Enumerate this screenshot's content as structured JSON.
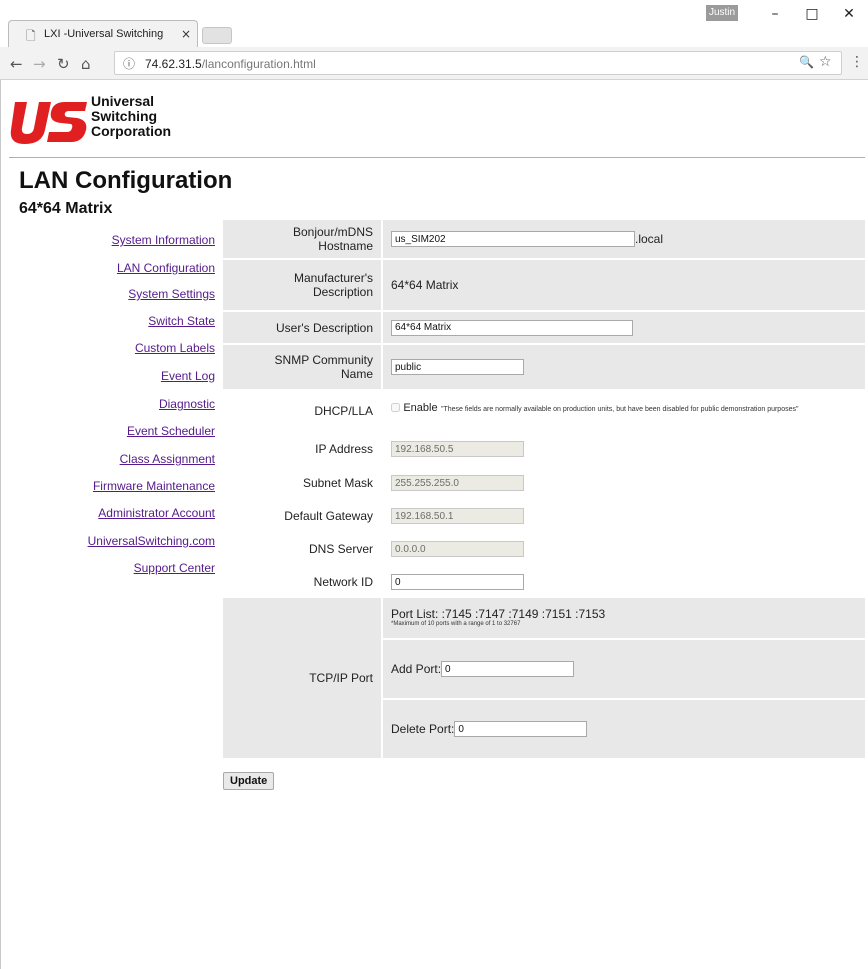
{
  "browser": {
    "tab_title": "LXI -Universal Switching",
    "tab_close": "×",
    "user_badge": "Justin",
    "url_host": "74.62.31.5",
    "url_path": "/lanconfiguration.html",
    "window_controls": {
      "minimize": "–",
      "maximize": "□",
      "close": "✕"
    }
  },
  "logo": {
    "line1": "Universal",
    "line2": "Switching",
    "line3": "Corporation",
    "mark": "US"
  },
  "page": {
    "title": "LAN Configuration",
    "subtitle": "64*64 Matrix"
  },
  "sidebar": {
    "items": [
      {
        "label": "System Information"
      },
      {
        "label": "LAN Configuration"
      },
      {
        "label": "System Settings"
      },
      {
        "label": "Switch State"
      },
      {
        "label": "Custom Labels"
      },
      {
        "label": "Event Log"
      },
      {
        "label": "Diagnostic"
      },
      {
        "label": "Event Scheduler"
      },
      {
        "label": "Class Assignment"
      },
      {
        "label": "Firmware Maintenance"
      },
      {
        "label": "Administrator Account"
      },
      {
        "label": "UniversalSwitching.com"
      },
      {
        "label": "Support Center"
      }
    ]
  },
  "form": {
    "hostname_label_1": "Bonjour/mDNS",
    "hostname_label_2": "Hostname",
    "hostname_value": "us_SIM202",
    "hostname_suffix": ".local",
    "mfr_label_1": "Manufacturer's",
    "mfr_label_2": "Description",
    "mfr_value": "64*64 Matrix",
    "user_desc_label": "User's Description",
    "user_desc_value": "64*64 Matrix",
    "snmp_label_1": "SNMP Community",
    "snmp_label_2": "Name",
    "snmp_value": "public",
    "dhcp_label": "DHCP/LLA",
    "dhcp_enable": "Enable",
    "dhcp_note": "\"These fields are normally available on production units, but have been disabled for public demonstration purposes\"",
    "ip_label": "IP Address",
    "ip_value": "192.168.50.5",
    "subnet_label": "Subnet Mask",
    "subnet_value": "255.255.255.0",
    "gateway_label": "Default Gateway",
    "gateway_value": "192.168.50.1",
    "dns_label": "DNS Server",
    "dns_value": "0.0.0.0",
    "netid_label": "Network ID",
    "netid_value": "0",
    "tcp_label": "TCP/IP Port",
    "port_list": "Port List: :7145 :7147 :7149 :7151 :7153",
    "port_note": "*Maximum of 10 ports with a range of 1 to 32767",
    "add_port_label": "Add Port:",
    "add_port_value": "0",
    "delete_port_label": "Delete Port:",
    "delete_port_value": "0",
    "update_label": "Update"
  }
}
